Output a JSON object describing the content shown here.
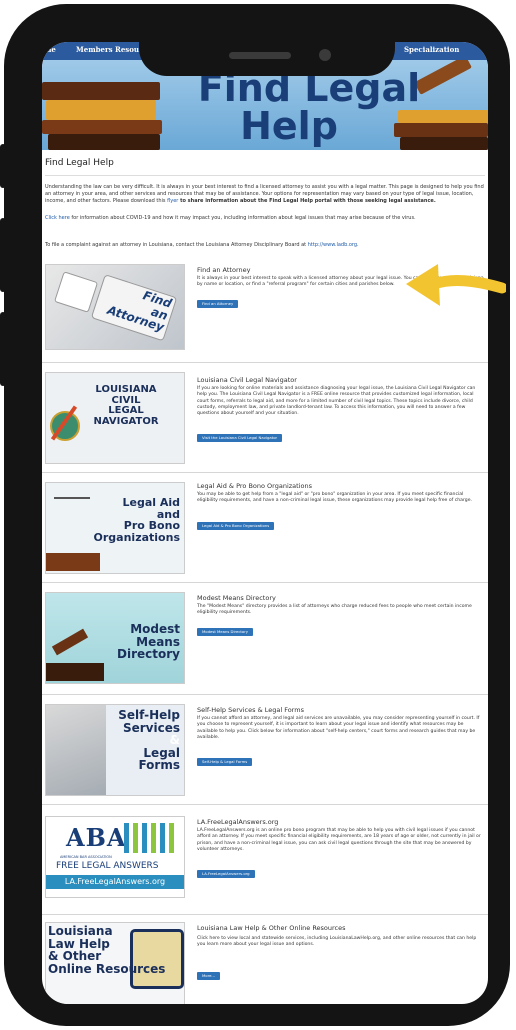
{
  "nav": {
    "items": [
      "me",
      "Members Resources",
      "Specialization"
    ]
  },
  "hero": {
    "title_line1": "Find Legal",
    "title_line2": "Help"
  },
  "page": {
    "title": "Find Legal Help",
    "intro_a": "Understanding the law can be very difficult. It is always in your best interest to find a licensed attorney to assist you with a legal matter. This page is designed to help you find an attorney in your area, and other services and resources that may be of assistance. Your options for representation may vary based on your type of legal issue, location, income, and other factors. Please download this ",
    "intro_link": "flyer",
    "intro_b": " to share information about the Find Legal Help portal with those seeking legal assistance.",
    "covid_link": "Click here",
    "covid_text": " for information about COVID-19 and how it may impact you, including information about legal issues that may arise because of the virus.",
    "complaint_text": "To file a complaint against an attorney in Louisiana, contact the Louisiana Attorney Disciplinary Board at ",
    "complaint_link": "http://www.ladb.org",
    "complaint_end": "."
  },
  "sections": [
    {
      "image_lines": [
        "Find",
        "an",
        "Attorney"
      ],
      "title": "Find an Attorney",
      "desc": "It is always in your best interest to speak with a licensed attorney about your legal issue. You can find attorneys in Louisiana by name or location, or find a \"referral program\" for certain cities and parishes below.",
      "button": "Find an Attorney"
    },
    {
      "image_lines": [
        "LOUISIANA",
        "CIVIL",
        "LEGAL",
        "NAVIGATOR"
      ],
      "title": "Louisiana Civil Legal Navigator",
      "desc": "If you are looking for online materials and assistance diagnosing your legal issue, the Louisiana Civil Legal Navigator can help you. The Louisiana Civil Legal Navigator is a FREE online resource that provides customized legal information, local court forms, referrals to legal aid, and more for a limited number of civil legal topics. These topics include divorce, child custody, employment law, and private landlord-tenant law. To access this information, you will need to answer a few questions about yourself and your situation.",
      "button": "Visit the Louisiana Civil Legal Navigator"
    },
    {
      "image_lines": [
        "Legal Aid",
        "and",
        "Pro Bono",
        "Organizations"
      ],
      "title": "Legal Aid & Pro Bono Organizations",
      "desc": "You may be able to get help from a \"legal aid\" or \"pro bono\" organization in your area. If you meet specific financial eligibility requirements, and have a non-criminal legal issue, these organizations may provide legal help free of charge.",
      "button": "Legal Aid & Pro Bono Organizations"
    },
    {
      "image_lines": [
        "Modest",
        "Means",
        "Directory"
      ],
      "title": "Modest Means Directory",
      "desc": "The \"Modest Means\" directory provides a list of attorneys who charge reduced fees to people who meet certain income eligibility requirements.",
      "button": "Modest Means Directory"
    },
    {
      "image_lines": [
        "Self-Help",
        "Services",
        "&",
        "Legal",
        "Forms"
      ],
      "title": "Self-Help Services & Legal Forms",
      "desc": "If you cannot afford an attorney, and legal aid services are unavailable, you may consider representing yourself in court. If you choose to represent yourself, it is important to learn about your legal issue and identify what resources may be available to help you. Click below for information about \"self-help centers,\" court forms and research guides that may be available.",
      "button": "Self-Help & Legal Forms"
    },
    {
      "image_lines": [
        "ABA",
        "AMERICAN BAR ASSOCIATION",
        "FREE LEGAL ANSWERS",
        "LA.FreeLegalAnswers.org"
      ],
      "title": "LA.FreeLegalAnswers.org",
      "desc": "LA.FreeLegalAnswers.org is an online pro bono program that may be able to help you with civil legal issues if you cannot afford an attorney. If you meet specific financial eligibility requirements, are 18 years of age or older, not currently in jail or prison, and have a non-criminal legal issue, you can ask civil legal questions through the site that may be answered by volunteer attorneys.",
      "button": "LA.FreeLegalAnswers.org"
    },
    {
      "image_lines": [
        "Louisiana",
        "Law Help",
        "& Other",
        "Online Resources"
      ],
      "title": "Louisiana Law Help & Other Online Resources",
      "desc": "Click here to view local and statewide services, including LouisianaLawHelp.org, and other online resources that can help you learn more about your legal issue and options.",
      "button": "More..."
    }
  ],
  "colors": {
    "accent": "#2e72b8",
    "nav": "#2c5a9e",
    "arrow": "#f2c530",
    "frame": "#141414"
  }
}
